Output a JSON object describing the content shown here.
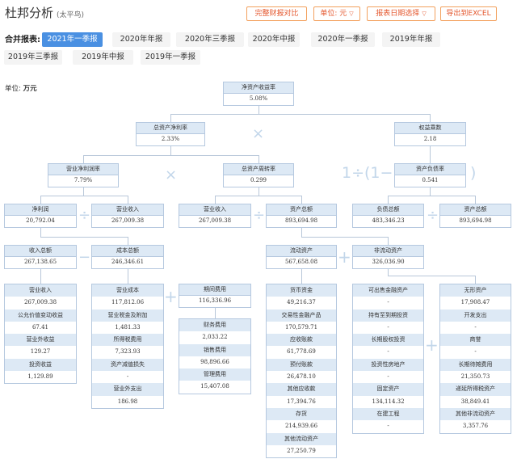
{
  "header": {
    "title": "杜邦分析",
    "subtitle": "(太平鸟)",
    "compare_label": "完整财报对比",
    "unit_label": "单位: 元",
    "date_select_label": "报表日期选择",
    "export_label": "导出到EXCEL"
  },
  "report": {
    "label": "合并报表:",
    "periods": [
      "2021年一季报",
      "2020年年报",
      "2020年三季报",
      "2020年中报",
      "2020年一季报",
      "2019年年报",
      "2019年三季报",
      "2019年中报",
      "2019年一季报"
    ]
  },
  "unit_note": {
    "label": "单位:",
    "value": "万元"
  },
  "tree": {
    "roe": {
      "label": "净资产收益率",
      "value": "5.08%"
    },
    "roa": {
      "label": "总资产净利率",
      "value": "2.33%"
    },
    "equity_multiplier": {
      "label": "权益乘数",
      "value": "2.18"
    },
    "net_margin": {
      "label": "营业净利润率",
      "value": "7.79%"
    },
    "asset_turnover": {
      "label": "总资产周转率",
      "value": "0.299"
    },
    "debt_ratio": {
      "label": "资产负债率",
      "value": "0.541"
    },
    "net_profit": {
      "label": "净利润",
      "value": "20,792.04"
    },
    "revenue_a": {
      "label": "营业收入",
      "value": "267,009.38"
    },
    "revenue_b": {
      "label": "营业收入",
      "value": "267,009.38"
    },
    "total_assets_a": {
      "label": "资产总额",
      "value": "893,694.98"
    },
    "total_liabilities": {
      "label": "负债总额",
      "value": "483,346.23"
    },
    "total_assets_b": {
      "label": "资产总额",
      "value": "893,694.98"
    },
    "total_income": {
      "label": "收入总额",
      "value": "267,138.65"
    },
    "total_cost": {
      "label": "成本总额",
      "value": "246,346.61"
    },
    "current_assets": {
      "label": "流动资产",
      "value": "567,658.08"
    },
    "noncurrent_assets": {
      "label": "非流动资产",
      "value": "326,036.90"
    }
  },
  "columns": {
    "income_detail": [
      [
        "营业收入",
        "267,009.38"
      ],
      [
        "公允价值变动收益",
        "67.41"
      ],
      [
        "营业外收益",
        "129.27"
      ],
      [
        "投资收益",
        "1,129.89"
      ]
    ],
    "cost_detail": [
      [
        "营业成本",
        "117,812.06"
      ],
      [
        "营业税金及附加",
        "1,481.33"
      ],
      [
        "所得税费用",
        "7,323.93"
      ],
      [
        "资产减值损失",
        "-"
      ],
      [
        "营业外支出",
        "186.98"
      ]
    ],
    "expense_total": {
      "label": "期间费用",
      "value": "116,336.96"
    },
    "expense_detail": [
      [
        "财务费用",
        "2,033.22"
      ],
      [
        "销售费用",
        "98,896.66"
      ],
      [
        "管理费用",
        "15,407.08"
      ]
    ],
    "current_detail": [
      [
        "货币资金",
        "49,216.37"
      ],
      [
        "交易性金融产品",
        "170,579.71"
      ],
      [
        "应收账款",
        "61,778.69"
      ],
      [
        "预付账款",
        "26,478.10"
      ],
      [
        "其他应收款",
        "17,394.76"
      ],
      [
        "存货",
        "214,939.66"
      ],
      [
        "其他流动资产",
        "27,250.79"
      ]
    ],
    "noncurrent_left": [
      [
        "可出售金融资产",
        "-"
      ],
      [
        "持有至到期投资",
        "-"
      ],
      [
        "长期股权投资",
        "-"
      ],
      [
        "投资性房地产",
        "-"
      ],
      [
        "固定资产",
        "134,114.32"
      ],
      [
        "在建工程",
        "-"
      ]
    ],
    "noncurrent_right": [
      [
        "无形资产",
        "17,908.47"
      ],
      [
        "开发支出",
        "-"
      ],
      [
        "商誉",
        "-"
      ],
      [
        "长期待摊费用",
        "21,350.73"
      ],
      [
        "递延所得税资产",
        "38,849.41"
      ],
      [
        "其他非流动资产",
        "3,357.76"
      ]
    ]
  }
}
